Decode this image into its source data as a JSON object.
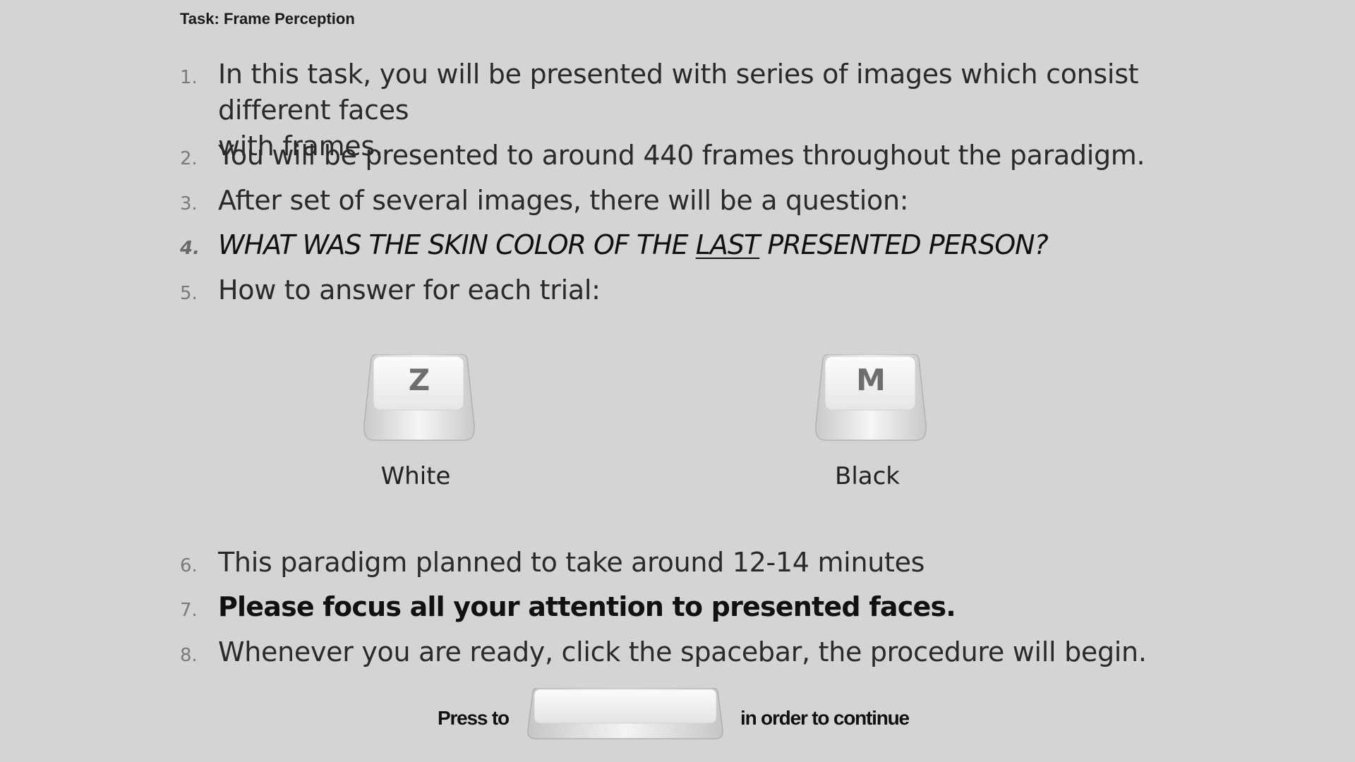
{
  "task_title": "Task: Frame Perception",
  "instructions": [
    {
      "number": "1.",
      "text_line1": "In this task, you will be presented with series of images which consist different faces",
      "text_line2": "with frames."
    },
    {
      "number": "2.",
      "text": "You will be presented to around 440 frames throughout the paradigm."
    },
    {
      "number": "3.",
      "text": "After set of several images, there will be a question:"
    },
    {
      "number": "4.",
      "text_before": "WHAT WAS THE SKIN COLOR OF THE ",
      "text_underlined": "LAST",
      "text_after": " PRESENTED PERSON?"
    },
    {
      "number": "5.",
      "text": "How to answer for each trial:"
    },
    {
      "number": "6.",
      "text": "This paradigm planned to take around 12-14 minutes"
    },
    {
      "number": "7.",
      "text": "Please focus all your attention to presented faces."
    },
    {
      "number": "8.",
      "text": "Whenever you are ready, click the spacebar, the procedure will begin."
    }
  ],
  "response_keys": [
    {
      "key": "Z",
      "label": "White",
      "icon": "z-key-icon"
    },
    {
      "key": "M",
      "label": "Black",
      "icon": "m-key-icon"
    }
  ],
  "footer": {
    "press_to": "Press to",
    "in_order_to_continue": "in order to continue",
    "key_icon": "spacebar-key-icon"
  }
}
